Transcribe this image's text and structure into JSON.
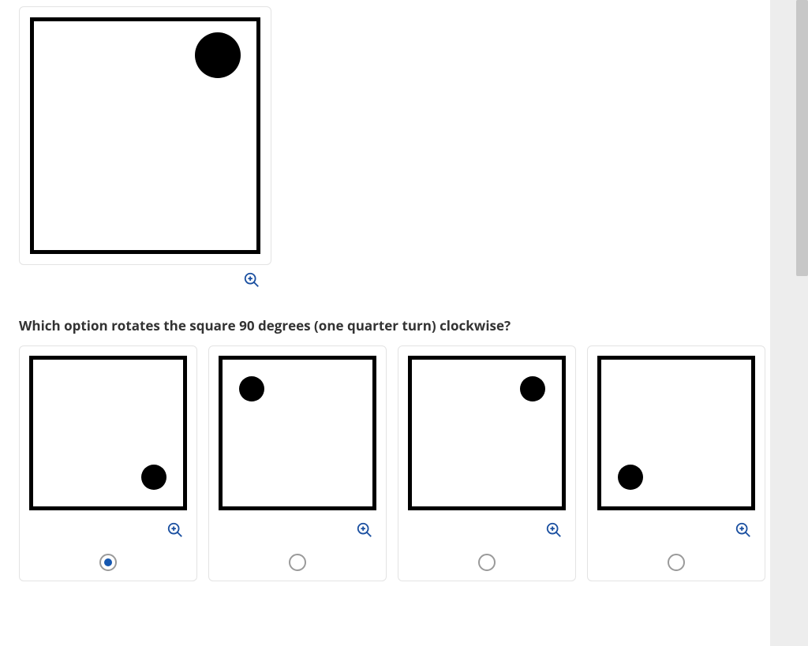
{
  "question": "Which option rotates the square 90 degrees (one quarter turn) clockwise?",
  "main_figure": {
    "dot_position": "top-right"
  },
  "options": [
    {
      "dot_position": "bottom-right",
      "selected": true
    },
    {
      "dot_position": "top-left",
      "selected": false
    },
    {
      "dot_position": "top-right",
      "selected": false
    },
    {
      "dot_position": "bottom-left",
      "selected": false
    }
  ],
  "icons": {
    "zoom": "zoom-in-icon"
  },
  "colors": {
    "accent": "#1557b0",
    "border": "#e3e3e3",
    "sidebar": "#ededed",
    "scroll": "#c7c7c7"
  }
}
